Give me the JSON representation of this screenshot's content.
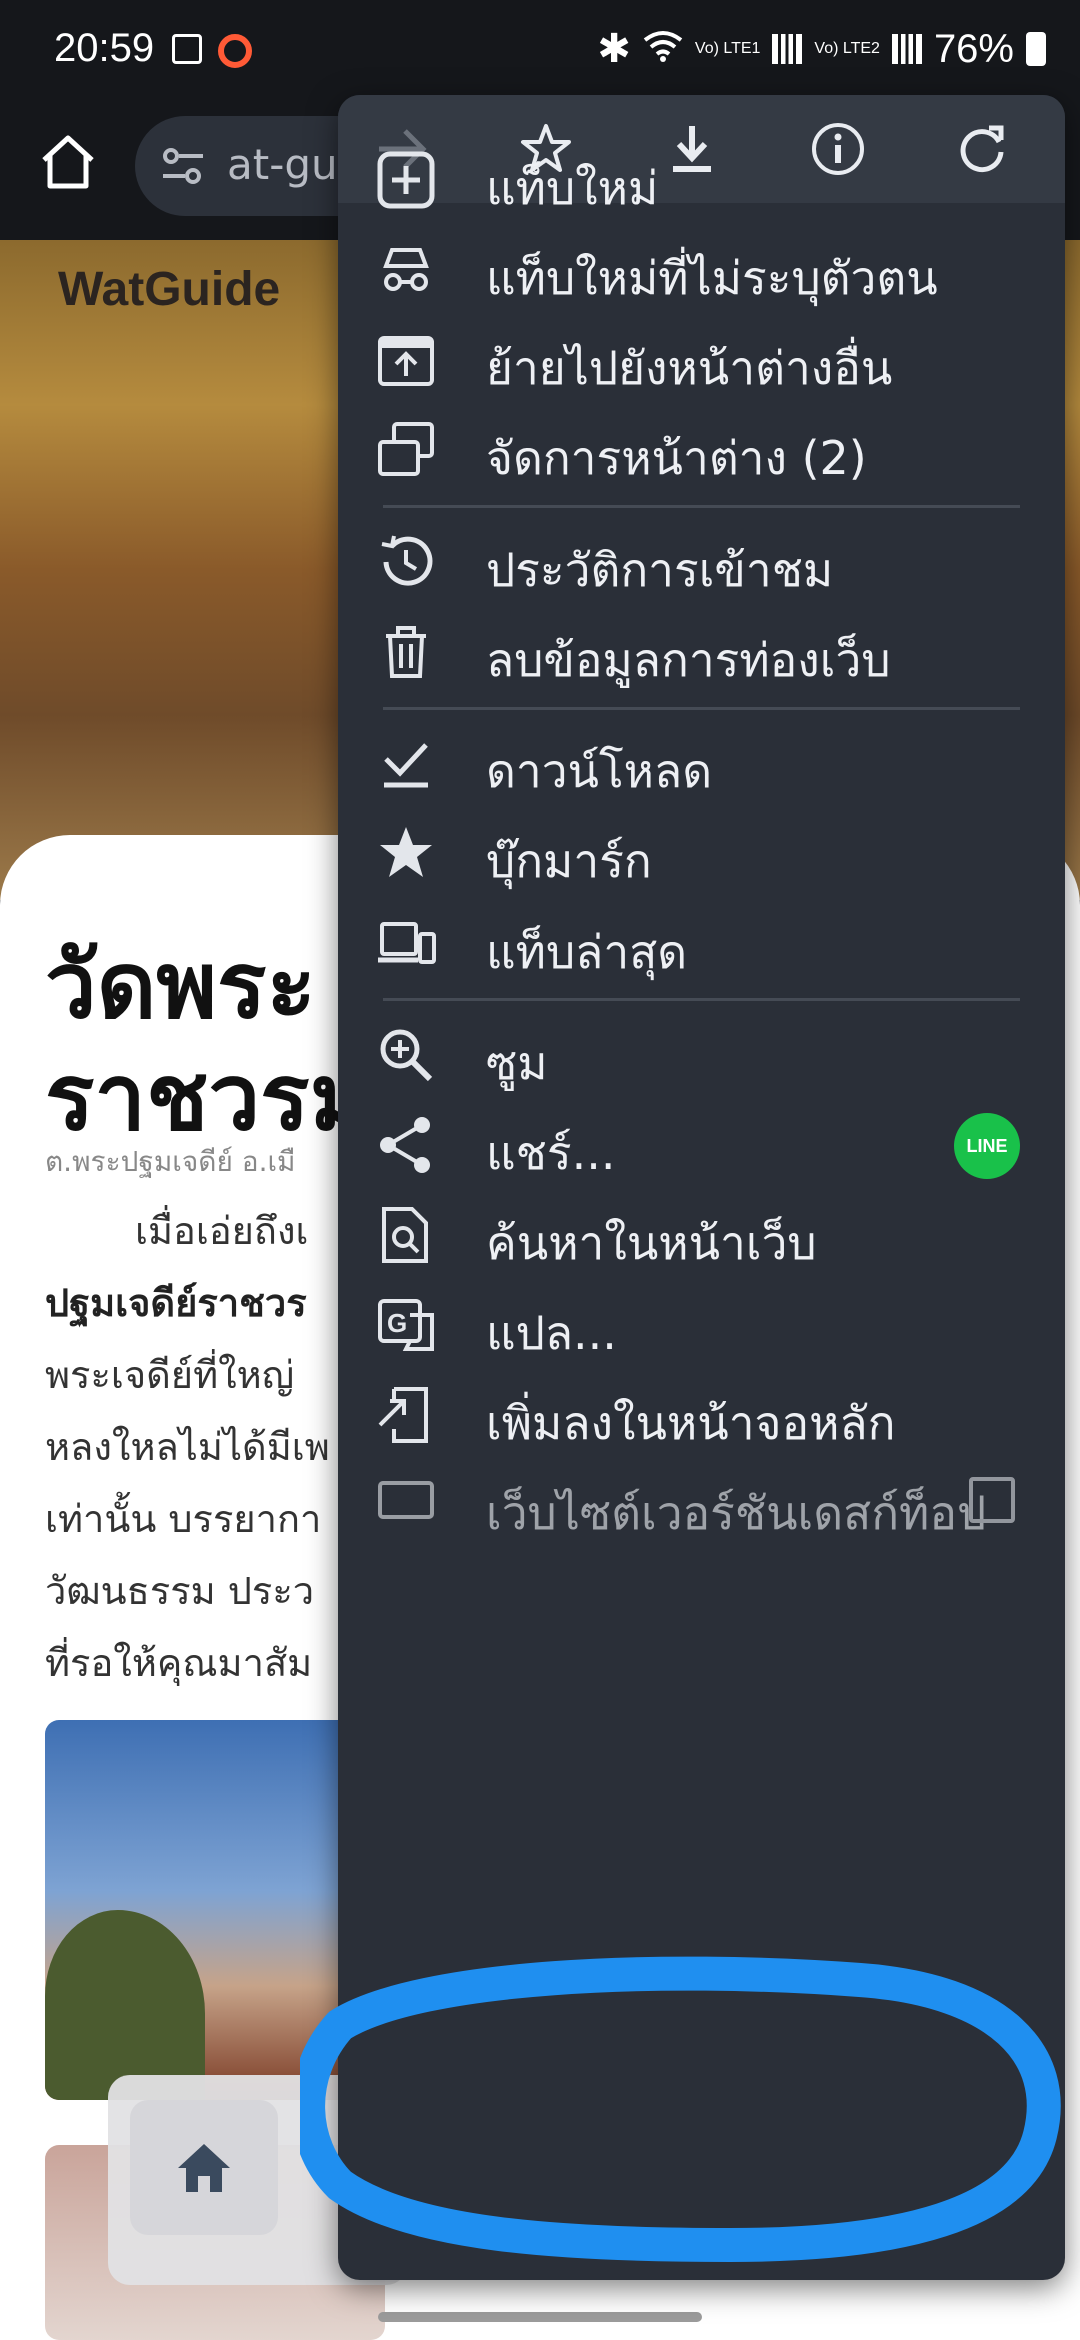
{
  "status_bar": {
    "time": "20:59",
    "battery": "76%",
    "sim1": "Vo) LTE1",
    "sim2": "Vo) LTE2"
  },
  "browser": {
    "url_fragment": "at-gu"
  },
  "page": {
    "logo": "WatGuide",
    "title_line1": "วัดพระ",
    "title_line2": "ราชวรม",
    "subtitle": "ต.พระปฐมเจดีย์ อ.เมื",
    "paragraph": [
      {
        "text": "เมื่อเอ่ยถึงเ",
        "bold": false,
        "indent": true
      },
      {
        "text": "ปฐมเจดีย์ราชวร",
        "bold": true,
        "indent": false
      },
      {
        "text": "พระเจดีย์ที่ใหญ่",
        "bold": false,
        "indent": false
      },
      {
        "text": "หลงใหลไม่ได้มีเพ",
        "bold": false,
        "indent": false
      },
      {
        "text": "เท่านั้น บรรยากา",
        "bold": false,
        "indent": false
      },
      {
        "text": "วัฒนธรรม ประว",
        "bold": false,
        "indent": false
      },
      {
        "text": "ที่รอให้คุณมาสัม",
        "bold": false,
        "indent": false
      }
    ]
  },
  "menu": {
    "items": [
      {
        "label": "แท็บใหม่",
        "icon": "new-tab-icon"
      },
      {
        "label": "แท็บใหม่ที่ไม่ระบุตัวตน",
        "icon": "incognito-icon"
      },
      {
        "label": "ย้ายไปยังหน้าต่างอื่น",
        "icon": "move-window-icon"
      },
      {
        "label": "จัดการหน้าต่าง (2)",
        "icon": "manage-windows-icon"
      },
      {
        "label": "ประวัติการเข้าชม",
        "icon": "history-icon"
      },
      {
        "label": "ลบข้อมูลการท่องเว็บ",
        "icon": "trash-icon"
      },
      {
        "label": "ดาวน์โหลด",
        "icon": "download-check-icon"
      },
      {
        "label": "บุ๊กมาร์ก",
        "icon": "star-filled-icon"
      },
      {
        "label": "แท็บล่าสุด",
        "icon": "recent-tabs-icon"
      },
      {
        "label": "ซูม",
        "icon": "zoom-icon"
      },
      {
        "label": "แชร์...",
        "icon": "share-icon"
      },
      {
        "label": "ค้นหาในหน้าเว็บ",
        "icon": "find-in-page-icon"
      },
      {
        "label": "แปล...",
        "icon": "translate-icon"
      },
      {
        "label": "เพิ่มลงในหน้าจอหลัก",
        "icon": "add-to-home-icon"
      },
      {
        "label": "เว็บไซต์เวอร์ชันเดสก์ท็อป",
        "icon": "desktop-site-icon"
      }
    ],
    "share_badge": "LINE"
  },
  "colors": {
    "menu_bg": "#2a2f38",
    "highlight": "#1f8ff0",
    "line_green": "#19c14a"
  }
}
